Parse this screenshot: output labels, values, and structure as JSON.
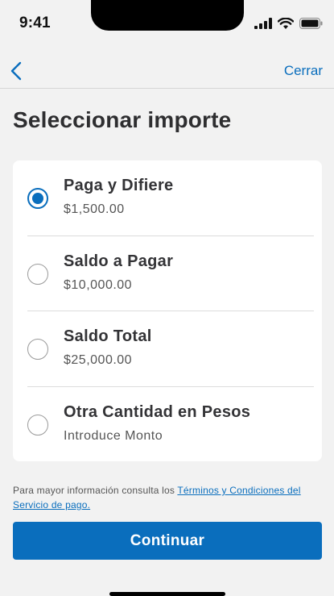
{
  "status_bar": {
    "time": "9:41"
  },
  "nav": {
    "close_label": "Cerrar"
  },
  "page": {
    "title": "Seleccionar importe"
  },
  "options": [
    {
      "title": "Paga y Difiere",
      "subtitle": "$1,500.00",
      "selected": true
    },
    {
      "title": "Saldo a Pagar",
      "subtitle": "$10,000.00",
      "selected": false
    },
    {
      "title": "Saldo Total",
      "subtitle": "$25,000.00",
      "selected": false
    },
    {
      "title": "Otra Cantidad en Pesos",
      "subtitle": "Introduce Monto",
      "selected": false
    }
  ],
  "terms": {
    "prefix": "Para mayor información consulta los ",
    "link": "Términos y Condiciones del Servicio de pago."
  },
  "actions": {
    "continue_label": "Continuar"
  },
  "colors": {
    "accent": "#0a6ebd",
    "background": "#f2f2f2"
  }
}
